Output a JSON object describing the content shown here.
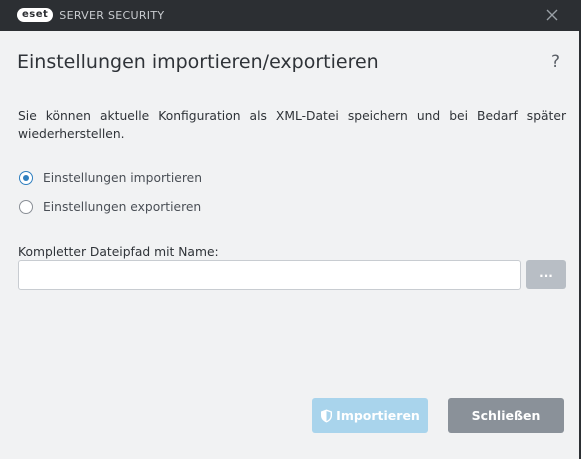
{
  "window": {
    "logo_text": "eset",
    "product_name": "SERVER SECURITY",
    "close_icon": "close-icon"
  },
  "dialog": {
    "title": "Einstellungen importieren/exportieren",
    "help_label": "?",
    "description": "Sie können aktuelle Konfiguration als XML-Datei speichern und bei Bedarf später wiederherstellen.",
    "options": [
      {
        "label": "Einstellungen importieren",
        "selected": true
      },
      {
        "label": "Einstellungen exportieren",
        "selected": false
      }
    ],
    "path_field": {
      "label": "Kompletter Dateipfad mit Name:",
      "value": "",
      "browse_label": "..."
    },
    "buttons": {
      "import_label": "Importieren",
      "import_enabled": false,
      "close_label": "Schließen"
    }
  },
  "colors": {
    "titlebar": "#2c2f33",
    "accent": "#2f7fbf",
    "import_disabled": "#a9d4ec",
    "close_button": "#8a9199"
  }
}
